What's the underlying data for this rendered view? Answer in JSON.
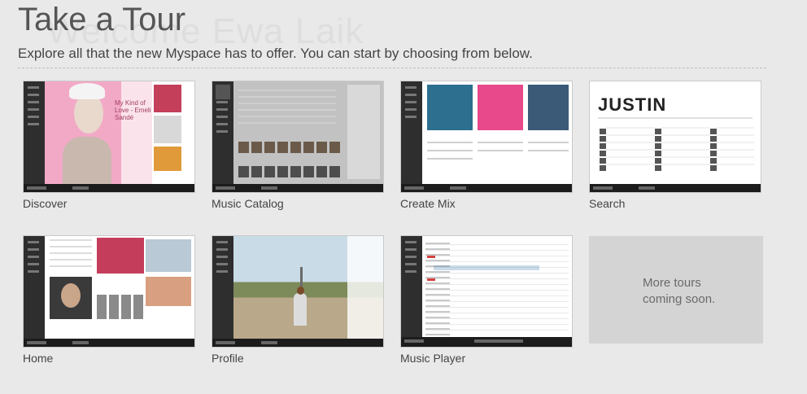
{
  "ghost_text": "Welcome Ewa Laik",
  "header": {
    "title": "Take a Tour",
    "subtitle": "Explore all that the new Myspace has to offer. You can start by choosing from below."
  },
  "tours": [
    {
      "label": "Discover"
    },
    {
      "label": "Music Catalog"
    },
    {
      "label": "Create Mix"
    },
    {
      "label": "Search"
    },
    {
      "label": "Home"
    },
    {
      "label": "Profile"
    },
    {
      "label": "Music Player"
    }
  ],
  "thumb_text": {
    "discover_song": "My Kind of Love - Emeli Sandé",
    "search_query": "JUSTIN"
  },
  "more": {
    "line1": "More tours",
    "line2": "coming soon."
  }
}
